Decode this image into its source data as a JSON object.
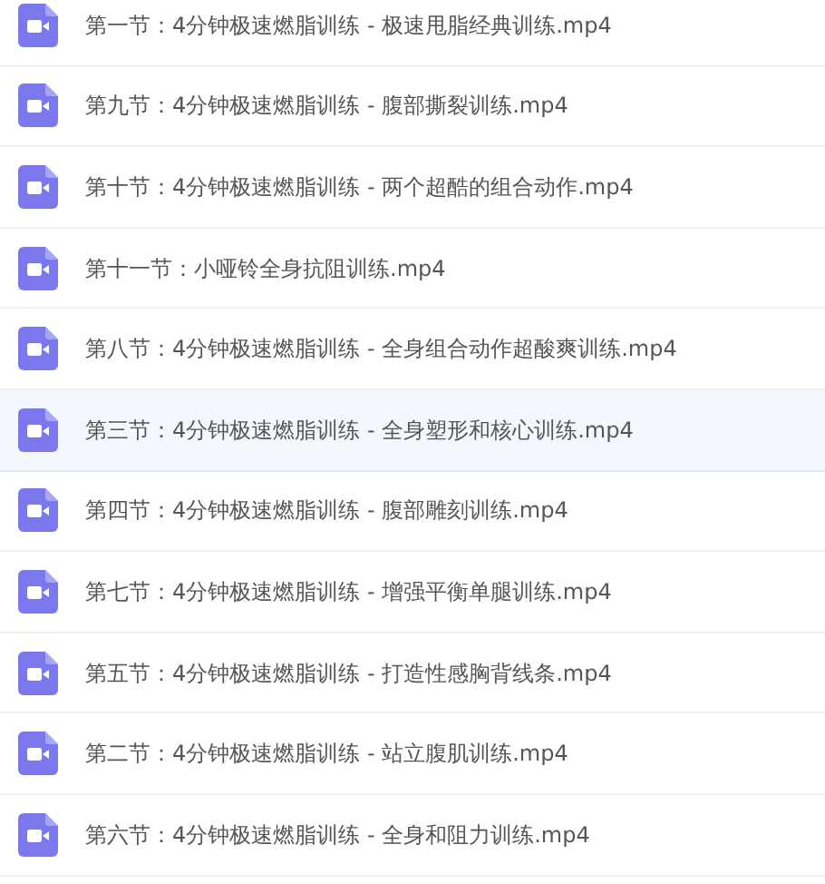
{
  "files": [
    {
      "name": "第一节：4分钟极速燃脂训练 - 极速甩脂经典训练.mp4",
      "selected": false
    },
    {
      "name": "第九节：4分钟极速燃脂训练 - 腹部撕裂训练.mp4",
      "selected": false
    },
    {
      "name": "第十节：4分钟极速燃脂训练 - 两个超酷的组合动作.mp4",
      "selected": false
    },
    {
      "name": "第十一节：小哑铃全身抗阻训练.mp4",
      "selected": false
    },
    {
      "name": "第八节：4分钟极速燃脂训练 - 全身组合动作超酸爽训练.mp4",
      "selected": false
    },
    {
      "name": "第三节：4分钟极速燃脂训练 - 全身塑形和核心训练.mp4",
      "selected": true
    },
    {
      "name": "第四节：4分钟极速燃脂训练 - 腹部雕刻训练.mp4",
      "selected": false
    },
    {
      "name": "第七节：4分钟极速燃脂训练 - 增强平衡单腿训练.mp4",
      "selected": false
    },
    {
      "name": "第五节：4分钟极速燃脂训练 - 打造性感胸背线条.mp4",
      "selected": false
    },
    {
      "name": "第二节：4分钟极速燃脂训练 - 站立腹肌训练.mp4",
      "selected": false
    },
    {
      "name": "第六节：4分钟极速燃脂训练 - 全身和阻力训练.mp4",
      "selected": false
    }
  ]
}
